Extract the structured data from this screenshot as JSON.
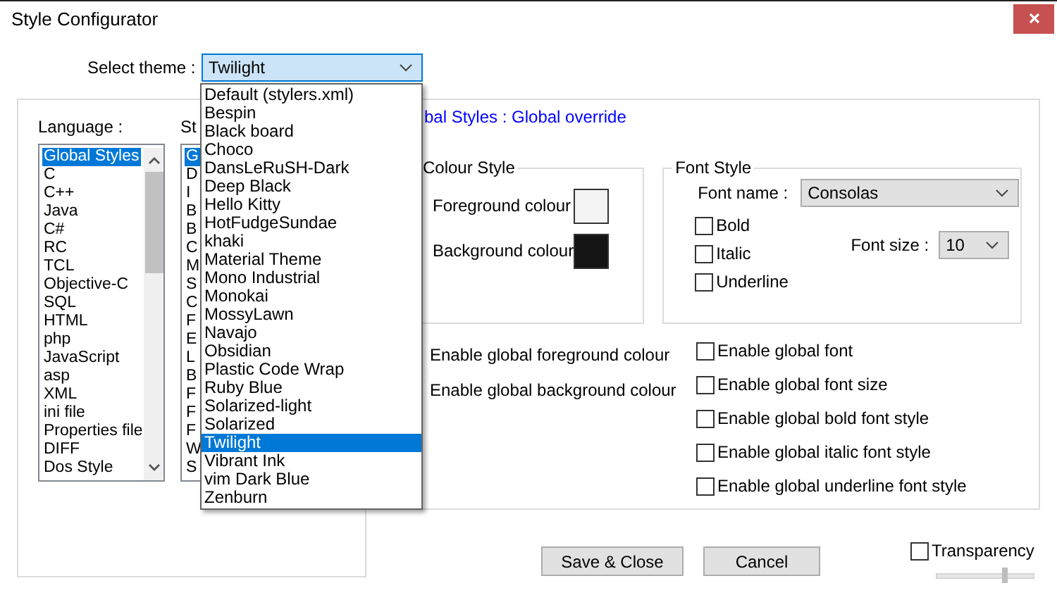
{
  "window": {
    "title": "Style Configurator"
  },
  "theme": {
    "label": "Select theme :",
    "value": "Twilight",
    "options": [
      {
        "label": "Default (stylers.xml)",
        "selected": false
      },
      {
        "label": "Bespin",
        "selected": false
      },
      {
        "label": "Black board",
        "selected": false
      },
      {
        "label": "Choco",
        "selected": false
      },
      {
        "label": "DansLeRuSH-Dark",
        "selected": false
      },
      {
        "label": "Deep Black",
        "selected": false
      },
      {
        "label": "Hello Kitty",
        "selected": false
      },
      {
        "label": "HotFudgeSundae",
        "selected": false
      },
      {
        "label": "khaki",
        "selected": false
      },
      {
        "label": "Material Theme",
        "selected": false
      },
      {
        "label": "Mono Industrial",
        "selected": false
      },
      {
        "label": "Monokai",
        "selected": false
      },
      {
        "label": "MossyLawn",
        "selected": false
      },
      {
        "label": "Navajo",
        "selected": false
      },
      {
        "label": "Obsidian",
        "selected": false
      },
      {
        "label": "Plastic Code Wrap",
        "selected": false
      },
      {
        "label": "Ruby Blue",
        "selected": false
      },
      {
        "label": "Solarized-light",
        "selected": false
      },
      {
        "label": "Solarized",
        "selected": false
      },
      {
        "label": "Twilight",
        "selected": true
      },
      {
        "label": "Vibrant Ink",
        "selected": false
      },
      {
        "label": "vim Dark Blue",
        "selected": false
      },
      {
        "label": "Zenburn",
        "selected": false
      }
    ]
  },
  "language": {
    "label": "Language :",
    "items": [
      {
        "label": "Global Styles",
        "selected": true
      },
      {
        "label": "C",
        "selected": false
      },
      {
        "label": "C++",
        "selected": false
      },
      {
        "label": "Java",
        "selected": false
      },
      {
        "label": "C#",
        "selected": false
      },
      {
        "label": "RC",
        "selected": false
      },
      {
        "label": "TCL",
        "selected": false
      },
      {
        "label": "Objective-C",
        "selected": false
      },
      {
        "label": "SQL",
        "selected": false
      },
      {
        "label": "HTML",
        "selected": false
      },
      {
        "label": "php",
        "selected": false
      },
      {
        "label": "JavaScript",
        "selected": false
      },
      {
        "label": "asp",
        "selected": false
      },
      {
        "label": "XML",
        "selected": false
      },
      {
        "label": "ini file",
        "selected": false
      },
      {
        "label": "Properties file",
        "selected": false
      },
      {
        "label": "DIFF",
        "selected": false
      },
      {
        "label": "Dos Style",
        "selected": false
      }
    ]
  },
  "style": {
    "label": "St",
    "items": [
      {
        "label": "G",
        "selected": true
      },
      {
        "label": "D",
        "selected": false
      },
      {
        "label": "I",
        "selected": false
      },
      {
        "label": "B",
        "selected": false
      },
      {
        "label": "B",
        "selected": false
      },
      {
        "label": "C",
        "selected": false
      },
      {
        "label": "M",
        "selected": false
      },
      {
        "label": "S",
        "selected": false
      },
      {
        "label": "C",
        "selected": false
      },
      {
        "label": "F",
        "selected": false
      },
      {
        "label": "E",
        "selected": false
      },
      {
        "label": "L",
        "selected": false
      },
      {
        "label": "B",
        "selected": false
      },
      {
        "label": "F",
        "selected": false
      },
      {
        "label": "F",
        "selected": false
      },
      {
        "label": "F",
        "selected": false
      },
      {
        "label": "W",
        "selected": false
      },
      {
        "label": "S",
        "selected": false
      }
    ]
  },
  "header": "bal Styles : Global override",
  "colour_style": {
    "title": "Colour Style",
    "swatches": [
      {
        "label": "Foreground colour",
        "color": "#f4f4f4"
      },
      {
        "label": "Background colour",
        "color": "#141414"
      }
    ]
  },
  "colour_options": [
    "Enable global foreground colour",
    "Enable global background colour"
  ],
  "font_style": {
    "title": "Font Style",
    "name_label": "Font name :",
    "name": "Consolas",
    "size_label": "Font size :",
    "size": "10",
    "styles": [
      {
        "label": "Bold",
        "checked": false
      },
      {
        "label": "Italic",
        "checked": false
      },
      {
        "label": "Underline",
        "checked": false
      }
    ]
  },
  "global_options": [
    {
      "label": "Enable global font",
      "checked": false
    },
    {
      "label": "Enable global font size",
      "checked": false
    },
    {
      "label": "Enable global bold font style",
      "checked": false
    },
    {
      "label": "Enable global italic font style",
      "checked": false
    },
    {
      "label": "Enable global underline font style",
      "checked": false
    }
  ],
  "buttons": [
    "Save & Close",
    "Cancel"
  ],
  "transparency": {
    "label": "Transparency",
    "checked": false,
    "level": 0.7
  }
}
